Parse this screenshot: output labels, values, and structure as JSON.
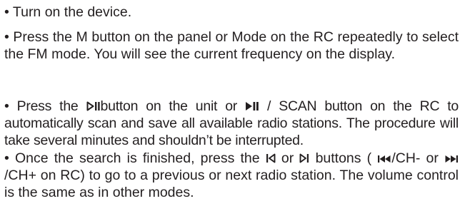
{
  "instructions": [
    {
      "bullet": "•",
      "text": "Turn on the device."
    },
    {
      "bullet": "•",
      "text": "Press the M button on the panel or Mode on the RC repeatedly to select the FM mode. You will see the current frequency on the display."
    },
    {
      "bullet": "•",
      "part1": "Press the",
      "icon1": "play-pause-icon",
      "part2": "button on the unit or",
      "icon2": "play-pause-filled-icon",
      "part3": "/ SCAN button on the RC to automatically scan and save all available radio stations. The procedure will take several minutes and shouldn’t be interrupted."
    },
    {
      "bullet": "•",
      "part1": "Once the search is finished, press the",
      "icon1": "previous-icon",
      "part2": "or",
      "icon2": "next-icon",
      "part3": "buttons (",
      "icon3": "skip-previous-icon",
      "part4": "/CH- or",
      "icon4": "skip-next-icon",
      "part5": "/CH+ on RC) to go to a previous or next radio station. The volume control is the same as in other modes."
    }
  ]
}
